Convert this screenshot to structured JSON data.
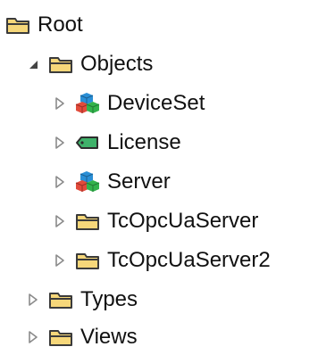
{
  "tree": {
    "nodes": [
      {
        "label": "Root",
        "icon": "folder-icon",
        "expander": "none"
      },
      {
        "label": "Objects",
        "icon": "folder-icon",
        "expander": "expanded"
      },
      {
        "label": "DeviceSet",
        "icon": "cubes-icon",
        "expander": "collapsed"
      },
      {
        "label": "License",
        "icon": "tag-icon",
        "expander": "collapsed"
      },
      {
        "label": "Server",
        "icon": "cubes-icon",
        "expander": "collapsed"
      },
      {
        "label": "TcOpcUaServer",
        "icon": "folder-icon",
        "expander": "collapsed"
      },
      {
        "label": "TcOpcUaServer2",
        "icon": "folder-icon",
        "expander": "collapsed"
      },
      {
        "label": "Types",
        "icon": "folder-icon",
        "expander": "collapsed"
      },
      {
        "label": "Views",
        "icon": "folder-icon",
        "expander": "collapsed"
      }
    ]
  },
  "colors": {
    "folder_fill": "#f6d77a",
    "folder_stroke": "#3b3b3b",
    "expander_collapsed": "#8a8a8a",
    "expander_expanded": "#444444",
    "tag_fill": "#3fb26a",
    "cube_blue": "#2a8fd6",
    "cube_green": "#32b24b",
    "cube_red": "#e14b3b"
  }
}
